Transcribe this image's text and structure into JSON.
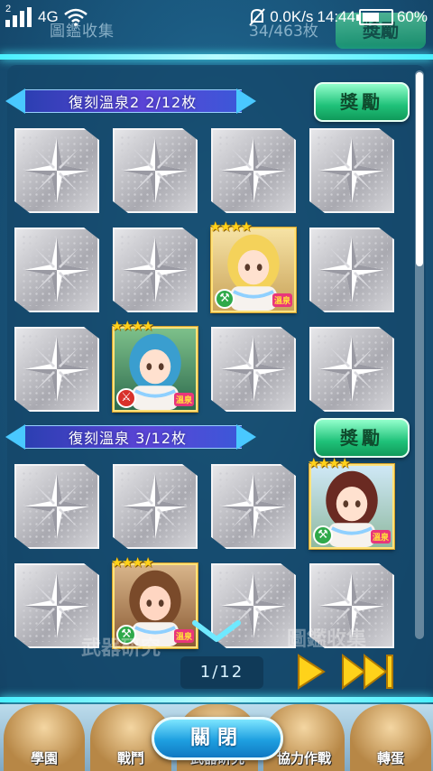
{
  "status_bar": {
    "sim": "2",
    "network": "4G",
    "speed": "0.0K/s",
    "time": "14:44",
    "battery": "60%",
    "battery_level": 0.6
  },
  "header": {
    "title": "圖鑑收集",
    "count": "34/463枚",
    "reward_label": "獎勵"
  },
  "sections": [
    {
      "label": "復刻溫泉2 2/12枚",
      "reward_label": "獎勵",
      "cards": [
        {
          "filled": false
        },
        {
          "filled": false
        },
        {
          "filled": false
        },
        {
          "filled": false
        },
        {
          "filled": false
        },
        {
          "filled": false
        },
        {
          "filled": true,
          "stars": "★★★★",
          "type": "green",
          "type_icon": "hammer-icon",
          "tag": "溫泉",
          "palette": "blonde"
        },
        {
          "filled": false
        },
        {
          "filled": false
        },
        {
          "filled": true,
          "stars": "★★★★",
          "type": "red",
          "type_icon": "sword-icon",
          "tag": "溫泉",
          "palette": "teal"
        },
        {
          "filled": false
        },
        {
          "filled": false
        }
      ]
    },
    {
      "label": "復刻溫泉 3/12枚",
      "reward_label": "獎勵",
      "cards": [
        {
          "filled": false
        },
        {
          "filled": false
        },
        {
          "filled": false
        },
        {
          "filled": true,
          "stars": "★★★★",
          "type": "green",
          "type_icon": "hammer-icon",
          "tag": "溫泉",
          "palette": "brunette"
        },
        {
          "filled": false
        },
        {
          "filled": true,
          "stars": "★★★★",
          "type": "green",
          "type_icon": "hammer-icon",
          "tag": "溫泉",
          "palette": "brown"
        },
        {
          "filled": false
        },
        {
          "filled": false
        }
      ]
    }
  ],
  "pager": {
    "page": "1/12",
    "current": 1,
    "total": 12
  },
  "bottom_nav": {
    "items": [
      "學園",
      "戰鬥",
      "武器研究",
      "協力作戰",
      "轉蛋"
    ],
    "background_labels": [
      "武器研究",
      "圖鑑收集"
    ]
  },
  "close_label": "關閉",
  "colors": {
    "accent_cyan": "#4af0ff",
    "reward_green": "#1fc179",
    "ribbon_purple": "#5b44d6",
    "star_gold": "#ffd21a"
  }
}
